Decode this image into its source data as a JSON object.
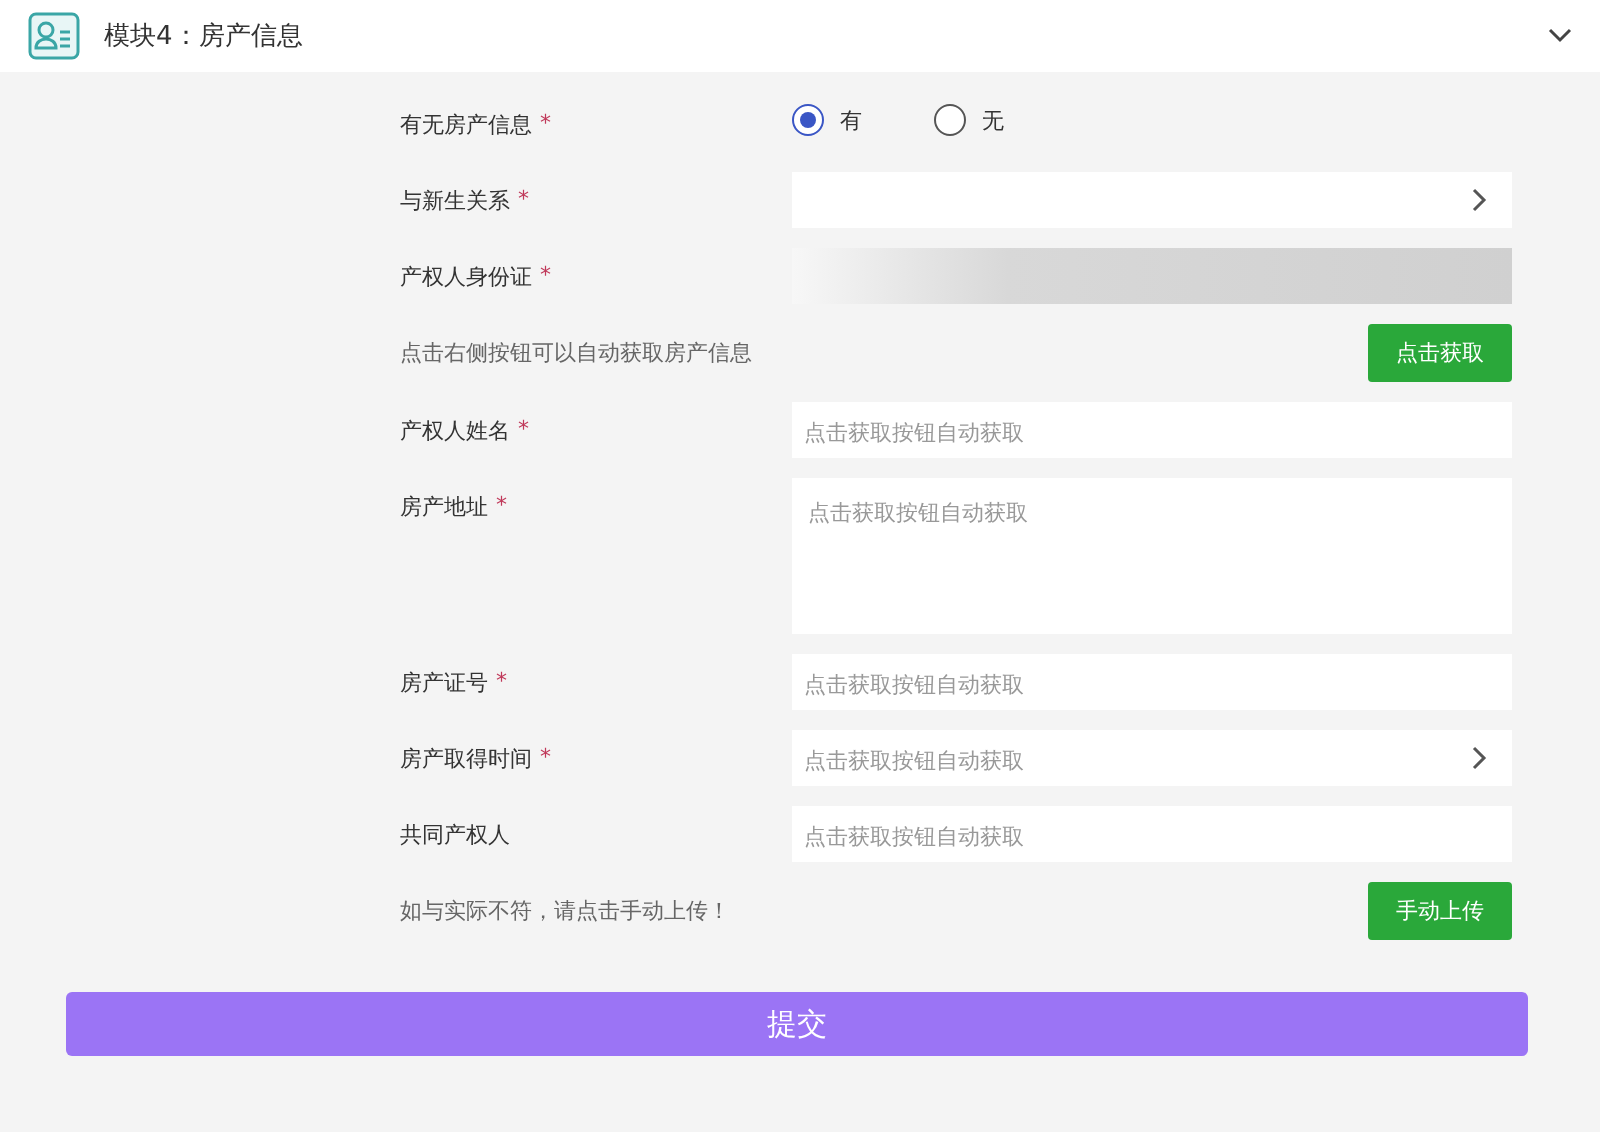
{
  "header": {
    "title": "模块4：房产信息",
    "expanded": true
  },
  "rows": [
    {
      "kind": "radio",
      "label": "有无房产信息",
      "mark": "*",
      "options": [
        {
          "label": "有",
          "selected": true
        },
        {
          "label": "无",
          "selected": false
        }
      ]
    },
    {
      "kind": "select",
      "label": "与新生关系",
      "mark": "*"
    },
    {
      "kind": "masked",
      "label": "产权人身份证",
      "mark": "*"
    },
    {
      "kind": "action",
      "label": "点击右侧按钮可以自动获取房产信息",
      "button": "点击获取"
    },
    {
      "kind": "input",
      "label": "产权人姓名",
      "mark": "*",
      "placeholder": "点击获取按钮自动获取"
    },
    {
      "kind": "textarea",
      "label": "房产地址",
      "mark": "*",
      "placeholder": "点击获取按钮自动获取"
    },
    {
      "kind": "input",
      "label": "房产证号",
      "mark": "*",
      "placeholder": "点击获取按钮自动获取"
    },
    {
      "kind": "select",
      "label": "房产取得时间",
      "mark": "*",
      "placeholder": "点击获取按钮自动获取"
    },
    {
      "kind": "input",
      "label": "共同产权人",
      "placeholder": "点击获取按钮自动获取"
    },
    {
      "kind": "action",
      "label": "如与实际不符，请点击手动上传！",
      "button": "手动上传"
    }
  ],
  "submit": "提交"
}
